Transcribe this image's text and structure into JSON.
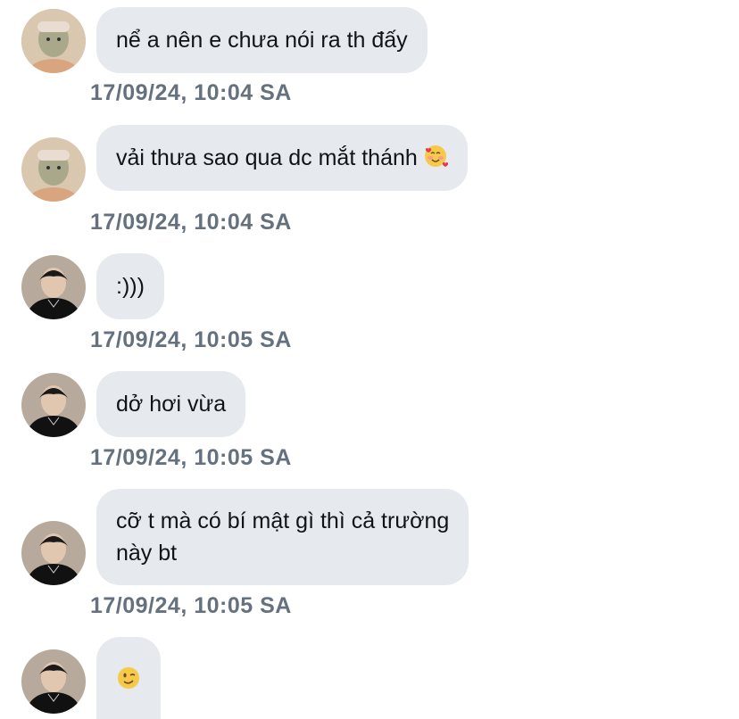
{
  "messages": [
    {
      "sender": "mask",
      "text": "nể a nên e chưa nói ra th đấy",
      "timestamp": "17/09/24, 10:04 SA"
    },
    {
      "sender": "mask",
      "text": "vải thưa sao qua dc mắt thánh",
      "emoji": "smiling-face-with-hearts",
      "timestamp": "17/09/24, 10:04 SA"
    },
    {
      "sender": "dark",
      "text": ":)))",
      "timestamp": "17/09/24, 10:05 SA"
    },
    {
      "sender": "dark",
      "text": "dở hơi vừa",
      "timestamp": "17/09/24, 10:05 SA"
    },
    {
      "sender": "dark",
      "lines": [
        "cỡ t mà có bí mật gì thì cả trường",
        "này bt"
      ],
      "timestamp": "17/09/24, 10:05 SA"
    },
    {
      "sender": "dark",
      "emoji": "winking-face",
      "text": ""
    }
  ],
  "colors": {
    "bubble_bg": "#e6eaef",
    "text": "#0f1419",
    "timestamp": "#65717e"
  }
}
